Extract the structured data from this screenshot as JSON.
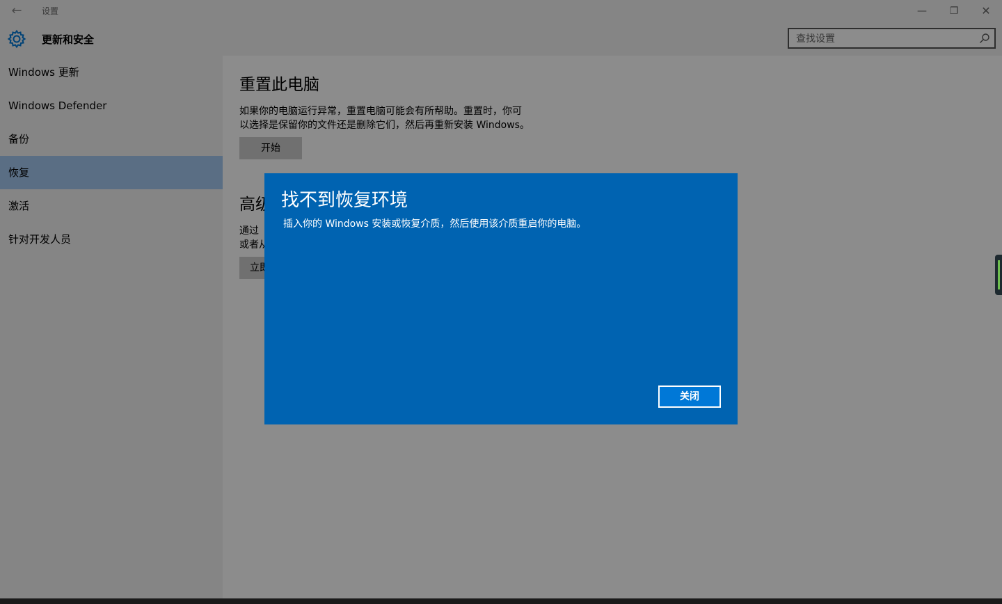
{
  "window": {
    "title": "设置"
  },
  "header": {
    "title": "更新和安全",
    "search_placeholder": "查找设置"
  },
  "sidebar": {
    "items": [
      {
        "label": "Windows 更新",
        "selected": false
      },
      {
        "label": "Windows Defender",
        "selected": false
      },
      {
        "label": "备份",
        "selected": false
      },
      {
        "label": "恢复",
        "selected": true
      },
      {
        "label": "激活",
        "selected": false
      },
      {
        "label": "针对开发人员",
        "selected": false
      }
    ]
  },
  "main": {
    "reset": {
      "title": "重置此电脑",
      "description_line1": "如果你的电脑运行异常，重置电脑可能会有所帮助。重置时，你可",
      "description_line2": "以选择是保留你的文件还是删除它们，然后再重新安装 Windows。",
      "button_label": "开始"
    },
    "advanced": {
      "title_partial": "高级",
      "description_line1_partial": "通过",
      "description_line2_partial": "或者从",
      "button_label_partial": "立即"
    }
  },
  "dialog": {
    "title": "找不到恢复环境",
    "message": "插入你的 Windows 安装或恢复介质，然后使用该介质重启你的电脑。",
    "close_label": "关闭"
  },
  "colors": {
    "dialog_bg": "#0063b1",
    "dialog_button_bg": "#0078d7",
    "accent": "#0078d7",
    "sidebar_selected": "#a4c8f0"
  }
}
